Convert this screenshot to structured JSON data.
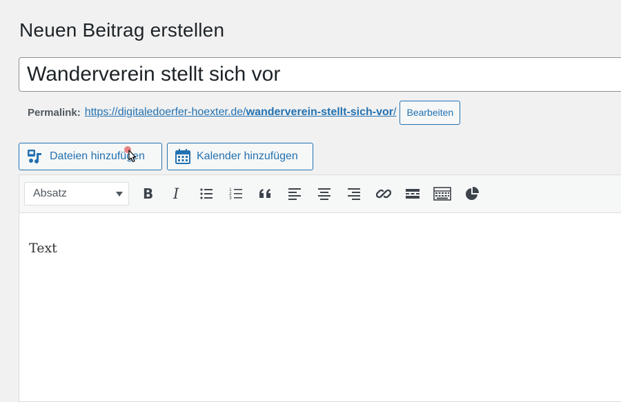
{
  "page": {
    "title": "Neuen Beitrag erstellen"
  },
  "post": {
    "title_value": "Wanderverein stellt sich vor"
  },
  "permalink": {
    "label": "Permalink:",
    "url_base": "https://digitaledoerfer-hoexter.de/",
    "slug": "wanderverein-stellt-sich-vor",
    "trailing": "/",
    "edit_label": "Bearbeiten"
  },
  "media_buttons": {
    "add_media": {
      "label": "Dateien hinzufügen",
      "icon": "media-icon"
    },
    "add_calendar": {
      "label": "Kalender hinzufügen",
      "icon": "calendar-icon"
    }
  },
  "toolbar": {
    "format_select": {
      "selected": "Absatz"
    },
    "buttons": [
      "bold-icon",
      "italic-icon",
      "bullet-list-icon",
      "numbered-list-icon",
      "blockquote-icon",
      "align-left-icon",
      "align-center-icon",
      "align-right-icon",
      "link-icon",
      "read-more-icon",
      "toolbar-toggle-icon",
      "chart-icon"
    ]
  },
  "editor": {
    "content": "Text"
  },
  "colors": {
    "accent": "#2271b1",
    "background": "#f1f1f1",
    "toolbar": "#f6f7f7"
  }
}
